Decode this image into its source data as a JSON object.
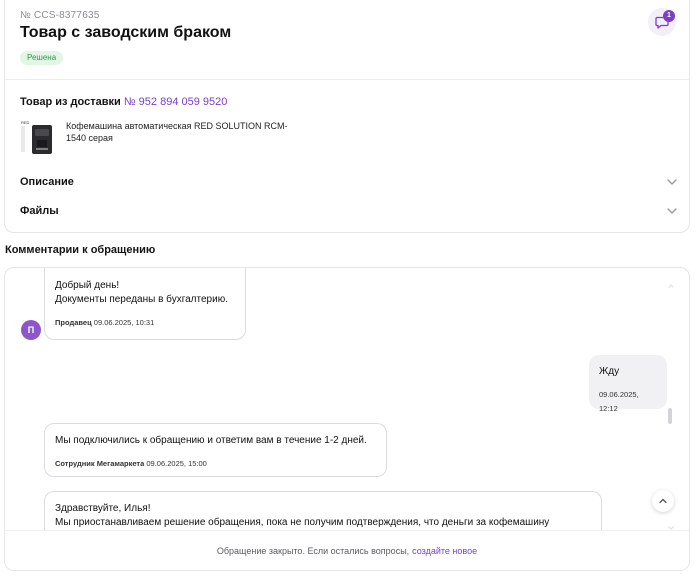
{
  "ticket": {
    "number": "№ CCS-8377635",
    "title": "Товар с заводским браком",
    "status": "Решена",
    "chat_badge_count": "1"
  },
  "delivery": {
    "label": "Товар из доставки",
    "link": "№ 952 894 059 9520"
  },
  "product": {
    "name": "Кофемашина автоматическая RED SOLUTION RCM-1540 серая"
  },
  "accordions": {
    "description": "Описание",
    "files": "Файлы"
  },
  "comments": {
    "title": "Комментарии к обращению",
    "messages": [
      {
        "line1": "Добрый день!",
        "line2": "Документы переданы в бухгалтерию.",
        "author": "Продавец",
        "time": "09.06.2025, 10:31",
        "avatar": "П"
      },
      {
        "line1": "Жду",
        "time": "09.06.2025, 12:12"
      },
      {
        "line1": "Мы подключились к обращению и ответим вам в течение 1-2 дней.",
        "author": "Сотрудник Мегамаркета",
        "time": "09.06.2025, 15:00"
      },
      {
        "line1": "Здравствуйте, Илья!",
        "line2": "Мы приостанавливаем решение обращения, пока не получим подтверждения, что деньги за кофемашину"
      }
    ]
  },
  "footer": {
    "closed_text": "Обращение закрыто. Если остались вопросы,",
    "create_link": "создайте новое"
  },
  "colors": {
    "accent": "#7b3fc9",
    "status_bg": "#e3f6e6",
    "status_text": "#2f9a45"
  }
}
